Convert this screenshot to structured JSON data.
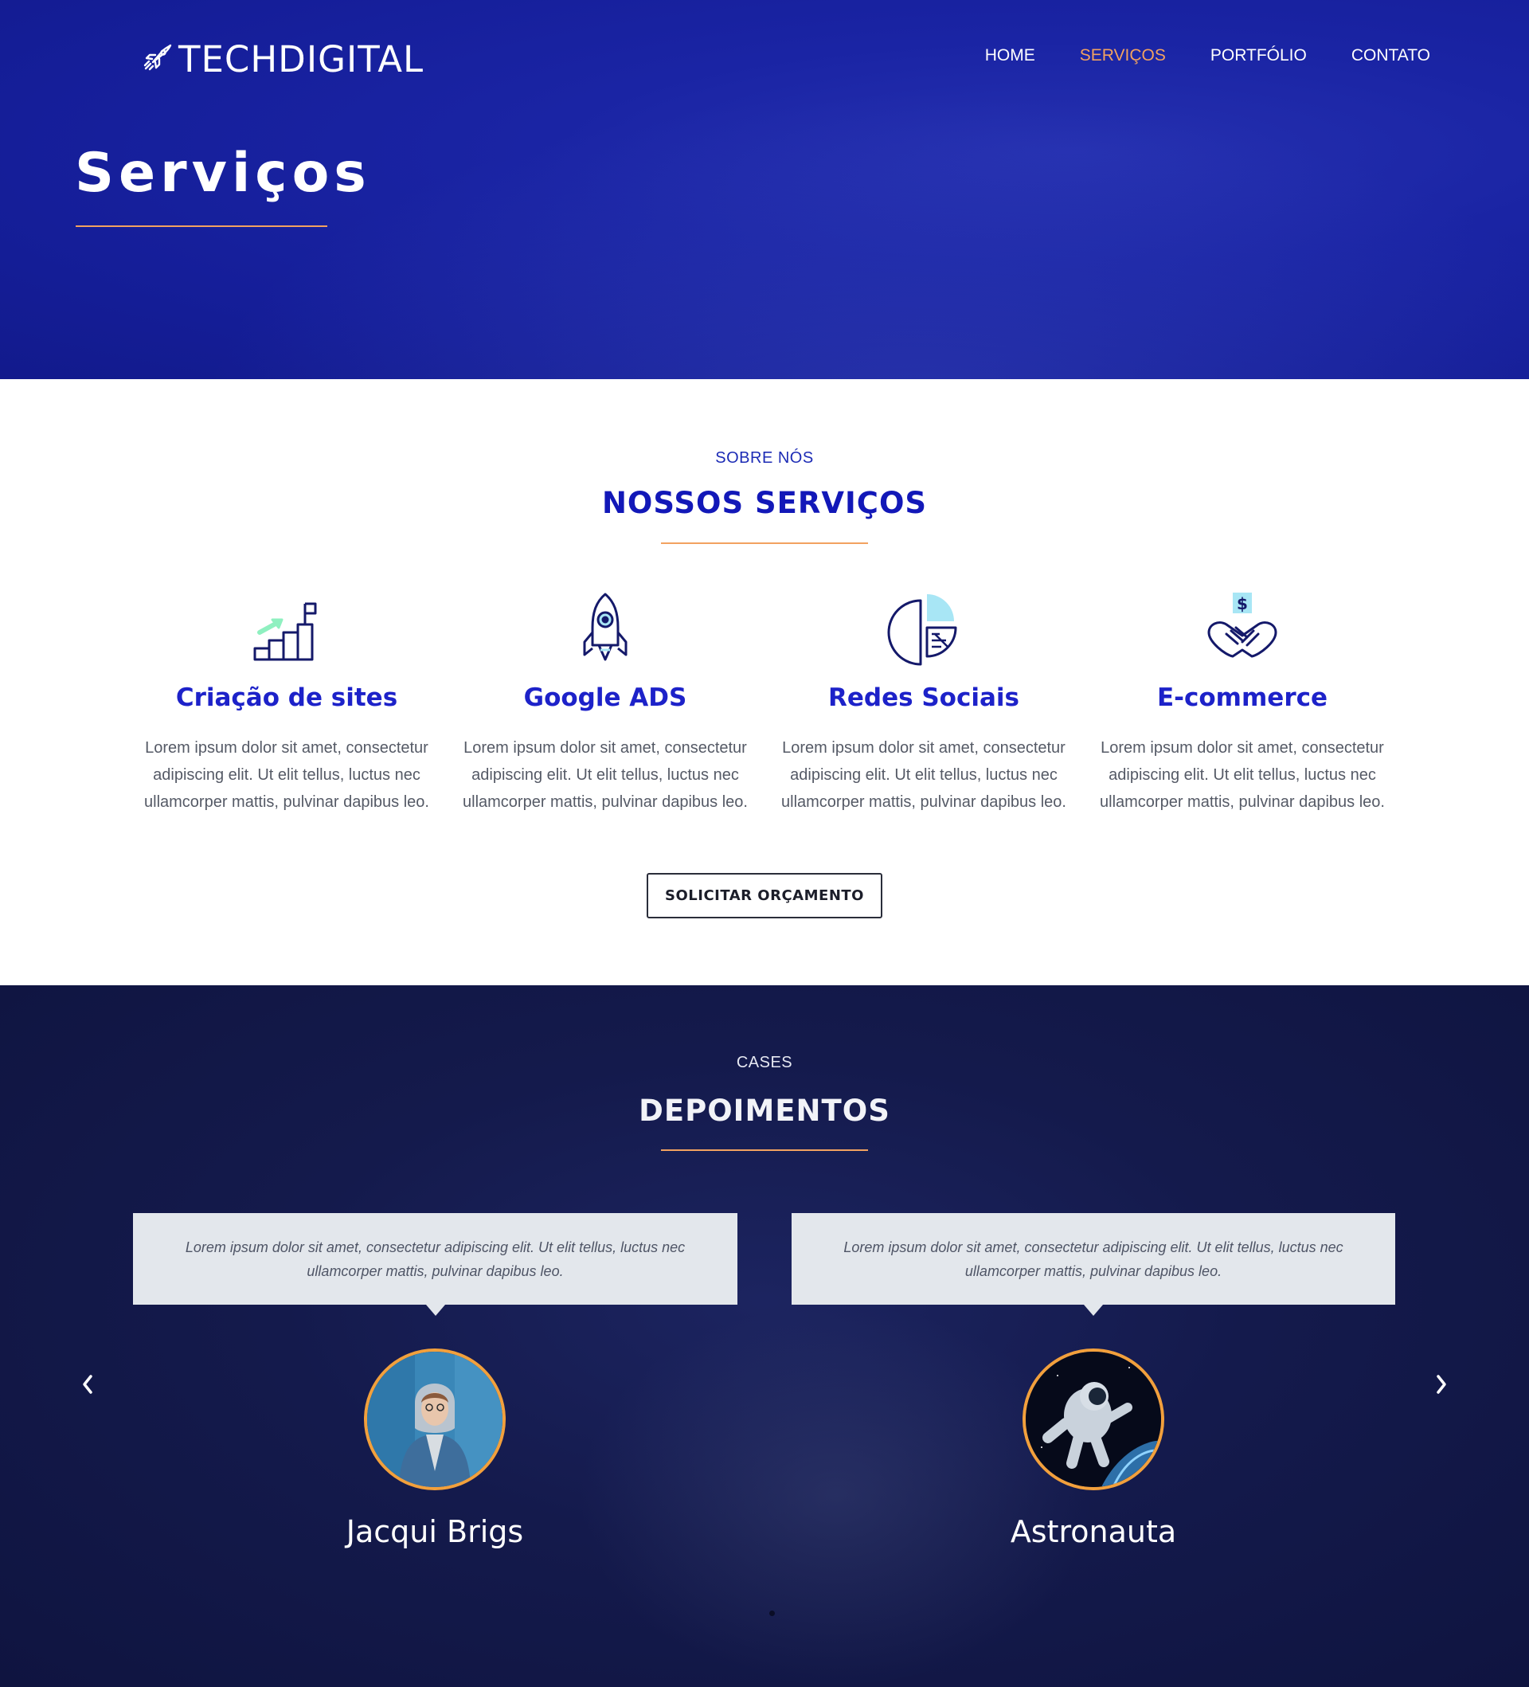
{
  "header": {
    "logo_text": "TECHDIGITAL",
    "nav": [
      {
        "label": "HOME",
        "active": false
      },
      {
        "label": "SERVIÇOS",
        "active": true
      },
      {
        "label": "PORTFÓLIO",
        "active": false
      },
      {
        "label": "CONTATO",
        "active": false
      }
    ]
  },
  "hero": {
    "title": "Serviços"
  },
  "services": {
    "eyebrow": "SOBRE NÓS",
    "title": "NOSSOS SERVIÇOS",
    "items": [
      {
        "icon": "growth-stairs-icon",
        "title": "Criação de sites",
        "text": "Lorem ipsum dolor sit amet, consectetur adipiscing elit. Ut elit tellus, luctus nec ullamcorper mattis, pulvinar dapibus leo."
      },
      {
        "icon": "rocket-icon",
        "title": "Google ADS",
        "text": "Lorem ipsum dolor sit amet, consectetur adipiscing elit. Ut elit tellus, luctus nec ullamcorper mattis, pulvinar dapibus leo."
      },
      {
        "icon": "pie-chart-icon",
        "title": "Redes Sociais",
        "text": "Lorem ipsum dolor sit amet, consectetur adipiscing elit. Ut elit tellus, luctus nec ullamcorper mattis, pulvinar dapibus leo."
      },
      {
        "icon": "handshake-dollar-icon",
        "title": "E-commerce",
        "text": "Lorem ipsum dolor sit amet, consectetur adipiscing elit. Ut elit tellus, luctus nec ullamcorper mattis, pulvinar dapibus leo."
      }
    ],
    "cta_label": "SOLICITAR ORÇAMENTO"
  },
  "testimonials": {
    "eyebrow": "CASES",
    "title": "DEPOIMENTOS",
    "items": [
      {
        "quote": "Lorem ipsum dolor sit amet, consectetur adipiscing elit. Ut elit tellus, luctus nec ullamcorper mattis, pulvinar dapibus leo.",
        "name": "Jacqui Brigs",
        "avatar": "woman-photo"
      },
      {
        "quote": "Lorem ipsum dolor sit amet, consectetur adipiscing elit. Ut elit tellus, luctus nec ullamcorper mattis, pulvinar dapibus leo.",
        "name": "Astronauta",
        "avatar": "astronaut-photo"
      }
    ],
    "prev_icon": "chevron-left-icon",
    "next_icon": "chevron-right-icon"
  },
  "colors": {
    "hero_bg": "#151e99",
    "accent_orange": "#f2a260",
    "title_blue": "#1d22c9",
    "dark_bg": "#141a4c"
  }
}
